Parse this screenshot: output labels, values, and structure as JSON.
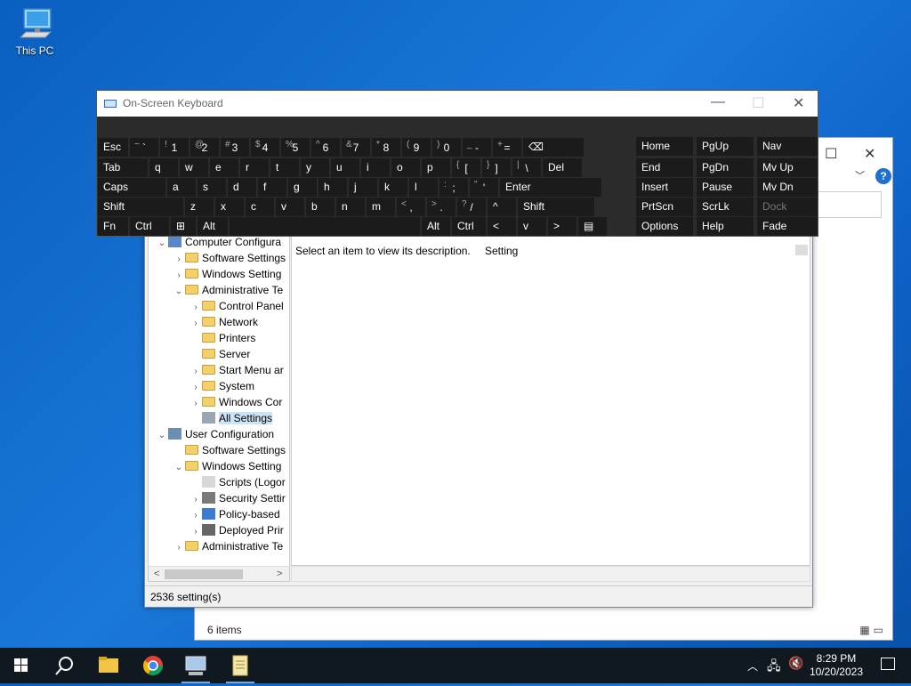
{
  "desktop": {
    "this_pc_label": "This PC"
  },
  "osk": {
    "title": "On-Screen Keyboard",
    "rows": [
      [
        {
          "main": "Esc"
        },
        {
          "sh": "~",
          "main": "`"
        },
        {
          "sh": "!",
          "main": "1"
        },
        {
          "sh": "@",
          "main": "2"
        },
        {
          "sh": "#",
          "main": "3"
        },
        {
          "sh": "$",
          "main": "4"
        },
        {
          "sh": "%",
          "main": "5"
        },
        {
          "sh": "^",
          "main": "6"
        },
        {
          "sh": "&",
          "main": "7"
        },
        {
          "sh": "*",
          "main": "8"
        },
        {
          "sh": "(",
          "main": "9"
        },
        {
          "sh": ")",
          "main": "0"
        },
        {
          "sh": "_",
          "main": "-"
        },
        {
          "sh": "+",
          "main": "="
        },
        {
          "main": "⌫"
        }
      ],
      [
        {
          "main": "Tab"
        },
        {
          "main": "q"
        },
        {
          "main": "w"
        },
        {
          "main": "e"
        },
        {
          "main": "r"
        },
        {
          "main": "t"
        },
        {
          "main": "y"
        },
        {
          "main": "u"
        },
        {
          "main": "i"
        },
        {
          "main": "o"
        },
        {
          "main": "p"
        },
        {
          "sh": "{",
          "main": "["
        },
        {
          "sh": "}",
          "main": "]"
        },
        {
          "sh": "|",
          "main": "\\"
        },
        {
          "main": "Del"
        }
      ],
      [
        {
          "main": "Caps"
        },
        {
          "main": "a"
        },
        {
          "main": "s"
        },
        {
          "main": "d"
        },
        {
          "main": "f"
        },
        {
          "main": "g"
        },
        {
          "main": "h"
        },
        {
          "main": "j"
        },
        {
          "main": "k"
        },
        {
          "main": "l"
        },
        {
          "sh": ":",
          "main": ";"
        },
        {
          "sh": "\"",
          "main": "'"
        },
        {
          "main": "Enter"
        }
      ],
      [
        {
          "main": "Shift"
        },
        {
          "main": "z"
        },
        {
          "main": "x"
        },
        {
          "main": "c"
        },
        {
          "main": "v"
        },
        {
          "main": "b"
        },
        {
          "main": "n"
        },
        {
          "main": "m"
        },
        {
          "sh": "<",
          "main": ","
        },
        {
          "sh": ">",
          "main": "."
        },
        {
          "sh": "?",
          "main": "/"
        },
        {
          "main": "^"
        },
        {
          "main": "Shift"
        }
      ],
      [
        {
          "main": "Fn"
        },
        {
          "main": "Ctrl"
        },
        {
          "main": "⊞"
        },
        {
          "main": "Alt"
        },
        {
          "main": ""
        },
        {
          "main": "Alt"
        },
        {
          "main": "Ctrl"
        },
        {
          "main": "<"
        },
        {
          "main": "v"
        },
        {
          "main": ">"
        },
        {
          "main": "▤"
        }
      ]
    ],
    "nav_keys": [
      [
        "Home",
        "PgUp",
        "Nav"
      ],
      [
        "End",
        "PgDn",
        "Mv Up"
      ],
      [
        "Insert",
        "Pause",
        "Mv Dn"
      ],
      [
        "PrtScn",
        "ScrLk",
        "Dock"
      ],
      [
        "Options",
        "Help",
        "Fade"
      ]
    ]
  },
  "gpedit": {
    "tree": [
      {
        "label": "Computer Configura",
        "level": 0,
        "arrow": "v",
        "icon": "computer"
      },
      {
        "label": "Software Settings",
        "level": 1,
        "arrow": ">",
        "icon": "folder"
      },
      {
        "label": "Windows Setting",
        "level": 1,
        "arrow": ">",
        "icon": "folder"
      },
      {
        "label": "Administrative Te",
        "level": 1,
        "arrow": "v",
        "icon": "folder"
      },
      {
        "label": "Control Panel",
        "level": 2,
        "arrow": ">",
        "icon": "folder"
      },
      {
        "label": "Network",
        "level": 2,
        "arrow": ">",
        "icon": "folder"
      },
      {
        "label": "Printers",
        "level": 2,
        "arrow": "",
        "icon": "folder"
      },
      {
        "label": "Server",
        "level": 2,
        "arrow": "",
        "icon": "folder"
      },
      {
        "label": "Start Menu ar",
        "level": 2,
        "arrow": ">",
        "icon": "folder"
      },
      {
        "label": "System",
        "level": 2,
        "arrow": ">",
        "icon": "folder"
      },
      {
        "label": "Windows Cor",
        "level": 2,
        "arrow": ">",
        "icon": "folder"
      },
      {
        "label": "All Settings",
        "level": 2,
        "arrow": "",
        "icon": "settings",
        "selected": true
      },
      {
        "label": "User Configuration",
        "level": 0,
        "arrow": "v",
        "icon": "user"
      },
      {
        "label": "Software Settings",
        "level": 1,
        "arrow": "",
        "icon": "folder"
      },
      {
        "label": "Windows Setting",
        "level": 1,
        "arrow": "v",
        "icon": "folder"
      },
      {
        "label": "Scripts (Logor",
        "level": 2,
        "arrow": "",
        "icon": "script"
      },
      {
        "label": "Security Settir",
        "level": 2,
        "arrow": ">",
        "icon": "security"
      },
      {
        "label": "Policy-based",
        "level": 2,
        "arrow": ">",
        "icon": "chart"
      },
      {
        "label": "Deployed Prir",
        "level": 2,
        "arrow": ">",
        "icon": "printer"
      },
      {
        "label": "Administrative Te",
        "level": 1,
        "arrow": ">",
        "icon": "folder"
      }
    ],
    "description": "Select an item to view its description.",
    "column_header": "Setting",
    "status": "2536 setting(s)"
  },
  "explorer": {
    "status": "6 items"
  },
  "taskbar": {
    "time": "8:29 PM",
    "date": "10/20/2023"
  },
  "colors": {
    "desktop_blue": "#0e63c8",
    "osk_key": "#1b1b1b",
    "taskbar": "#101820"
  }
}
